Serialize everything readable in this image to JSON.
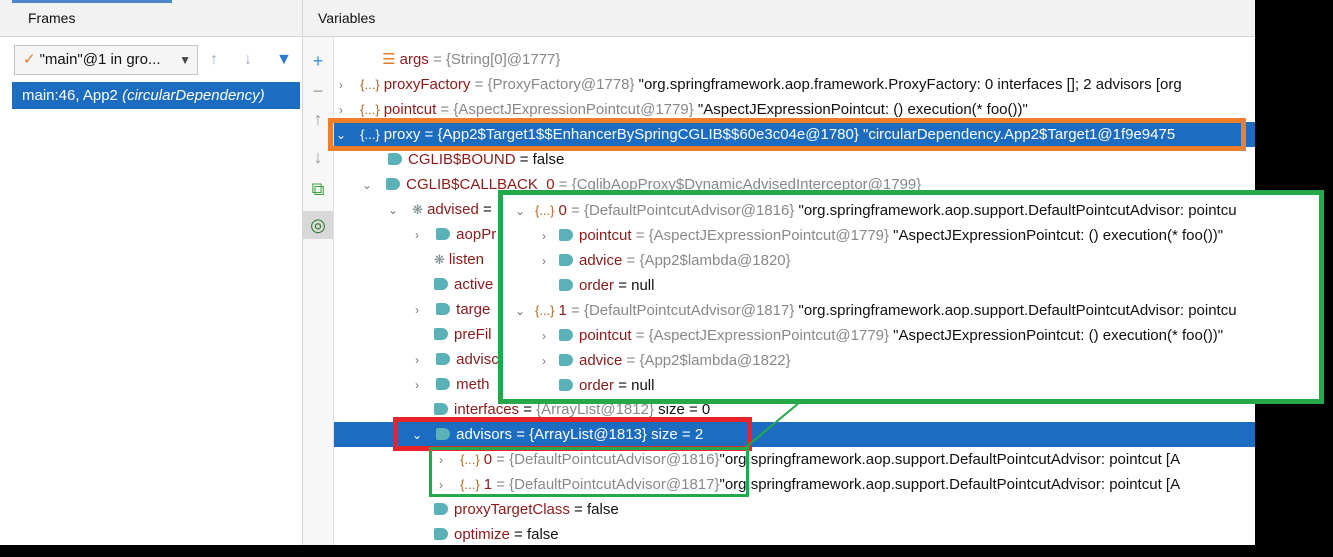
{
  "frames_panel": {
    "title": "Frames",
    "thread_selector": "\"main\"@1 in gro...",
    "frames": [
      {
        "location": "main:46, App2",
        "class": "(circularDependency)"
      }
    ]
  },
  "variables_panel": {
    "title": "Variables",
    "rows": [
      {
        "name": "args",
        "value": " = {String[0]@1777}"
      },
      {
        "name": "proxyFactory",
        "ref": " = {ProxyFactory@1778}",
        "text": " \"org.springframework.aop.framework.ProxyFactory: 0 interfaces []; 2 advisors [org"
      },
      {
        "name": "pointcut",
        "ref": " = {AspectJExpressionPointcut@1779}",
        "text": " \"AspectJExpressionPointcut: () execution(* foo())\""
      },
      {
        "name": "proxy",
        "value": " = {App2$Target1$$EnhancerBySpringCGLIB$$60e3c04e@1780} \"circularDependency.App2$Target1@1f9e9475"
      },
      {
        "name": "CGLIB$BOUND",
        "value": " = false"
      },
      {
        "name": "CGLIB$CALLBACK_0",
        "ref": " = {CglibAopProxy$DynamicAdvisedInterceptor@1799}"
      },
      {
        "name": "advised",
        "value": " ="
      },
      {
        "name": "aopPr"
      },
      {
        "name": "listen"
      },
      {
        "name": "active"
      },
      {
        "name": "targe"
      },
      {
        "name": "preFil"
      },
      {
        "name": "advisc"
      },
      {
        "name": "meth"
      },
      {
        "name": "interfaces",
        "value": " = ",
        "ref": "{ArrayList@1812}",
        "text": "  size = 0"
      },
      {
        "name": "advisors",
        "value": " = {ArrayList@1813}  size = 2"
      },
      {
        "name": "0",
        "ref": " = {DefaultPointcutAdvisor@1816}",
        "text": "\"org.springframework.aop.support.DefaultPointcutAdvisor: pointcut [A"
      },
      {
        "name": "1",
        "ref": " = {DefaultPointcutAdvisor@1817}",
        "text": "\"org.springframework.aop.support.DefaultPointcutAdvisor: pointcut [A"
      },
      {
        "name": "proxyTargetClass",
        "value": " = false"
      },
      {
        "name": "optimize",
        "value": " = false"
      }
    ]
  },
  "zoom_box": {
    "rows": [
      {
        "name": "0",
        "ref": " = {DefaultPointcutAdvisor@1816}",
        "text": " \"org.springframework.aop.support.DefaultPointcutAdvisor: pointcu"
      },
      {
        "name": "pointcut",
        "ref": " = {AspectJExpressionPointcut@1779}",
        "text": " \"AspectJExpressionPointcut: () execution(* foo())\""
      },
      {
        "name": "advice",
        "ref": " = {App2$lambda@1820}"
      },
      {
        "name": "order",
        "value": " = null"
      },
      {
        "name": "1",
        "ref": " = {DefaultPointcutAdvisor@1817}",
        "text": " \"org.springframework.aop.support.DefaultPointcutAdvisor: pointcu"
      },
      {
        "name": "pointcut",
        "ref": " = {AspectJExpressionPointcut@1779}",
        "text": " \"AspectJExpressionPointcut: () execution(* foo())\""
      },
      {
        "name": "advice",
        "ref": " = {App2$lambda@1822}"
      },
      {
        "name": "order",
        "value": " = null"
      }
    ]
  },
  "icons": {
    "obj": "{...}"
  },
  "colors": {
    "selection": "#1c6dc1",
    "orange_box": "#f07d28",
    "red_box": "#e8232a",
    "green_box": "#24a84a"
  }
}
